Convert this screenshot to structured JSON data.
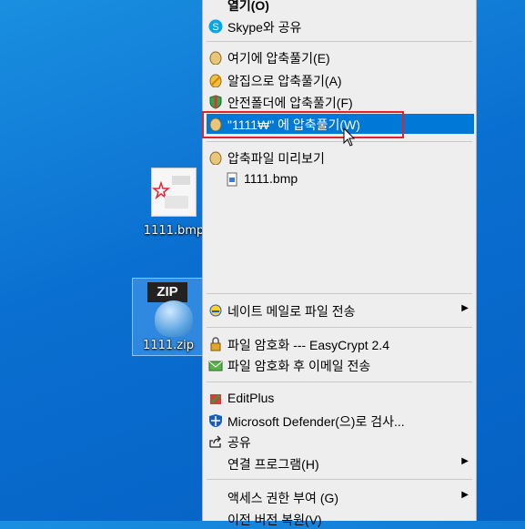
{
  "desktop": {
    "bmp_label": "1111.bmp",
    "zip_label": "1111.zip",
    "zip_tag": "ZIP"
  },
  "menu": {
    "open": "열기(O)",
    "skype": "Skype와 공유",
    "extract_here": "여기에 압축풀기(E)",
    "alzip_extract": "알집으로 압축풀기(A)",
    "safe_extract": "안전폴더에 압축풀기(F)",
    "extract_to": "\"1111₩\" 에 압축풀기(W)",
    "preview": "압축파일 미리보기",
    "preview_file": "1111.bmp",
    "nate_send": "네이트 메일로 파일 전송",
    "encrypt": "파일 암호화 --- EasyCrypt 2.4",
    "encrypt_mail": "파일 암호화 후 이메일 전송",
    "editplus": "EditPlus",
    "defender": "Microsoft Defender(으)로 검사...",
    "share": "공유",
    "open_with": "연결 프로그램(H)",
    "access": "액세스 권한 부여 (G)",
    "restore": "이전 버전 복원(V)"
  },
  "colors": {
    "highlight": "#0078d7",
    "annotation_box": "#e0242b"
  },
  "icons": [
    "skype-icon",
    "alzip-egg-icon",
    "shield-icon",
    "bmp-file-icon",
    "nate-mail-icon",
    "lock-icon",
    "mail-lock-icon",
    "editplus-icon",
    "defender-icon",
    "share-icon"
  ]
}
